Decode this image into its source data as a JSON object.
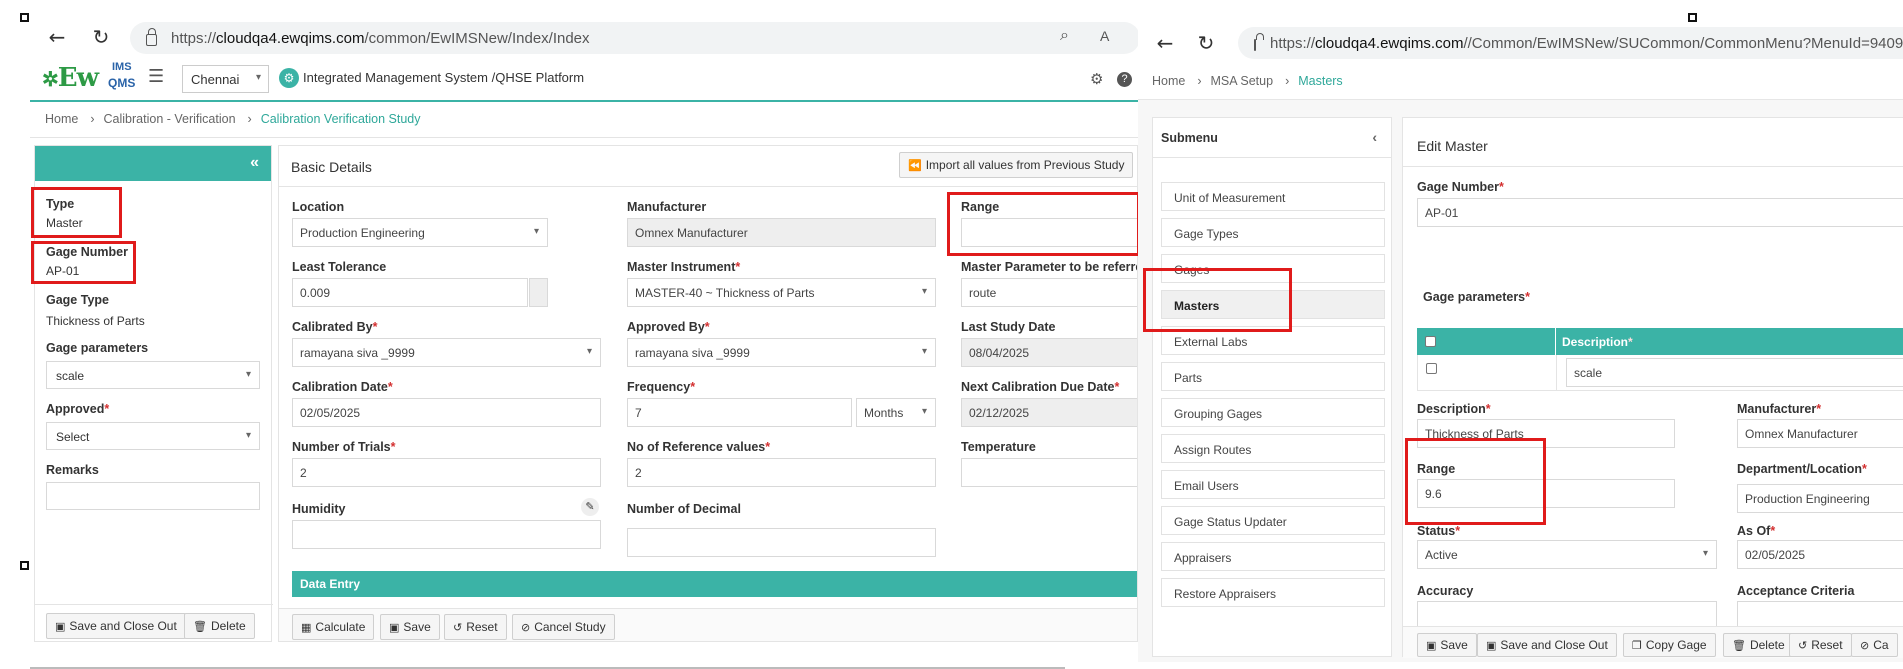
{
  "left_browser": {
    "url_prefix": "https://",
    "url_domain": "cloudqa4.ewqims.com",
    "url_path": "/common/EwIMSNew/Index/Index"
  },
  "right_browser": {
    "url_prefix": "https://",
    "url_domain": "cloudqa4.ewqims.com",
    "url_path": "//Common/EwIMSNew/SUCommon/CommonMenu?MenuId=9409"
  },
  "app": {
    "logo_text": "Ew",
    "logo_ims": "IMS",
    "logo_qms": "QMS",
    "city": "Chennai",
    "system_title": "Integrated Management System /QHSE Platform",
    "accent": "#3bb3a6"
  },
  "left_breadcrumb": [
    "Home",
    "Calibration - Verification",
    "Calibration Verification Study"
  ],
  "sidebar": {
    "type_label": "Type",
    "type_value": "Master",
    "gage_number_label": "Gage Number",
    "gage_number_value": "AP-01",
    "gage_type_label": "Gage Type",
    "gage_type_value": "Thickness of Parts",
    "gage_params_label": "Gage parameters",
    "gage_params_value": "scale",
    "approved_label": "Approved",
    "approved_value": "Select",
    "remarks_label": "Remarks",
    "remarks_value": "",
    "save_close": "Save and Close Out",
    "delete": "Delete"
  },
  "basic": {
    "title": "Basic Details",
    "import_btn": "Import all values from Previous Study",
    "location_label": "Location",
    "location_value": "Production Engineering",
    "manufacturer_label": "Manufacturer",
    "manufacturer_value": "Omnex Manufacturer",
    "range_label": "Range",
    "range_value": "",
    "least_tol_label": "Least Tolerance",
    "least_tol_value": "0.009",
    "master_inst_label": "Master Instrument",
    "master_inst_value": "MASTER-40 ~ Thickness of Parts",
    "master_param_label": "Master Parameter to be referred",
    "master_param_value": "route",
    "calibrated_by_label": "Calibrated By",
    "calibrated_by_value": "ramayana siva _9999",
    "approved_by_label": "Approved By",
    "approved_by_value": "ramayana siva _9999",
    "last_study_label": "Last Study Date",
    "last_study_value": "08/04/2025",
    "cal_date_label": "Calibration Date",
    "cal_date_value": "02/05/2025",
    "frequency_label": "Frequency",
    "frequency_value": "7",
    "frequency_unit": "Months",
    "next_due_label": "Next Calibration Due Date",
    "next_due_value": "02/12/2025",
    "trials_label": "Number of Trials",
    "trials_value": "2",
    "ref_values_label": "No of Reference values",
    "ref_values_value": "2",
    "temperature_label": "Temperature",
    "temperature_value": "",
    "humidity_label": "Humidity",
    "humidity_value": "",
    "decimal_label": "Number of Decimal",
    "decimal_value": "",
    "data_entry": "Data Entry",
    "calculate": "Calculate",
    "save": "Save",
    "reset": "Reset",
    "cancel_study": "Cancel Study"
  },
  "right_breadcrumb": [
    "Home",
    "MSA Setup",
    "Masters"
  ],
  "submenu": {
    "title": "Submenu",
    "items": [
      "Unit of Measurement",
      "Gage Types",
      "Gages",
      "Masters",
      "External Labs",
      "Parts",
      "Grouping Gages",
      "Assign Routes",
      "Email Users",
      "Gage Status Updater",
      "Appraisers",
      "Restore Appraisers"
    ]
  },
  "edit_master": {
    "title": "Edit Master",
    "gage_number_label": "Gage Number",
    "gage_number_value": "AP-01",
    "gage_params_label": "Gage parameters",
    "desc_col": "Description",
    "param_row": "scale",
    "description_label": "Description",
    "description_value": "Thickness of Parts",
    "manufacturer_label": "Manufacturer",
    "manufacturer_value": "Omnex Manufacturer",
    "range_label": "Range",
    "range_value": "9.6",
    "dept_label": "Department/Location",
    "dept_value": "Production Engineering",
    "status_label": "Status",
    "status_value": "Active",
    "asof_label": "As Of",
    "asof_value": "02/05/2025",
    "accuracy_label": "Accuracy",
    "acceptance_label": "Acceptance Criteria",
    "save": "Save",
    "save_close": "Save and Close Out",
    "copy_gage": "Copy Gage",
    "delete": "Delete",
    "reset": "Reset",
    "cancel_partial": "Ca"
  }
}
